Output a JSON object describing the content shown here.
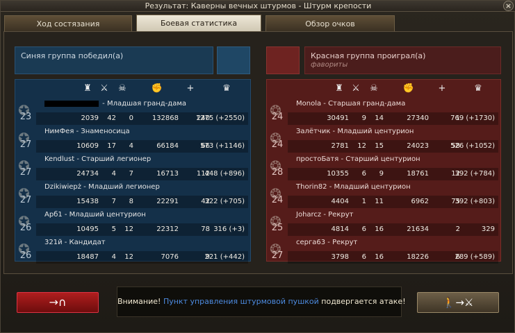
{
  "title": "Результат: Каверны вечных штурмов - Штурм крепости",
  "tabs": [
    "Ход состязания",
    "Боевая статистика",
    "Обзор очков"
  ],
  "blue": {
    "result": "Синяя группа победил(а)",
    "players": [
      {
        "level": "23",
        "name": " - Младшая гранд-дама",
        "redacted": true,
        "stats": [
          "2039",
          "42",
          "0",
          "132868",
          "240",
          "1275 (+2550)"
        ]
      },
      {
        "level": "27",
        "name": "НимФея - Знаменосица",
        "stats": [
          "10609",
          "17",
          "4",
          "66184",
          "66",
          "573 (+1146)"
        ]
      },
      {
        "level": "27",
        "name": "Kendlust - Старший легионер",
        "stats": [
          "24734",
          "4",
          "7",
          "16713",
          "112",
          "448 (+896)"
        ]
      },
      {
        "level": "27",
        "name": "Dzikiwiepż - Младший легионер",
        "stats": [
          "15438",
          "7",
          "8",
          "22291",
          "42",
          "322 (+705)"
        ]
      },
      {
        "level": "26",
        "name": "Арб1 - Младший центурион",
        "stats": [
          "10495",
          "5",
          "12",
          "22312",
          "78",
          "316 (+3)"
        ]
      },
      {
        "level": "26",
        "name": "321й - Кандидат",
        "stats": [
          "18487",
          "4",
          "12",
          "7076",
          "9",
          "221 (+442)"
        ]
      }
    ]
  },
  "red": {
    "result": "Красная группа проиграл(а)",
    "favorite": "фавориты",
    "players": [
      {
        "level": "24",
        "name": "Monola - Старшая гранд-дама",
        "stats": [
          "30491",
          "9",
          "14",
          "27340",
          "1",
          "769 (+1730)"
        ]
      },
      {
        "level": "24",
        "name": "Залётчик - Младший центурион",
        "stats": [
          "2781",
          "12",
          "15",
          "24023",
          "58",
          "526 (+1052)"
        ]
      },
      {
        "level": "28",
        "name": "простоБатя - Старший центурион",
        "stats": [
          "10355",
          "6",
          "9",
          "18761",
          "12",
          "392 (+784)"
        ]
      },
      {
        "level": "24",
        "name": "Thorin82 - Младший центурион",
        "stats": [
          "4404",
          "1",
          "11",
          "6962",
          "75",
          "392 (+803)"
        ]
      },
      {
        "level": "25",
        "name": "Joharcz - Рекрут",
        "stats": [
          "4814",
          "6",
          "16",
          "21634",
          "2",
          "329"
        ]
      },
      {
        "level": "27",
        "name": "серга63 - Рекрут",
        "stats": [
          "3798",
          "6",
          "16",
          "18226",
          "6",
          "289 (+589)"
        ]
      }
    ]
  },
  "notice": {
    "warning": "Внимание!",
    "target": "Пункт управления штурмовой пушкой",
    "text": "подвергается атаке!"
  },
  "icons": {
    "tower": "♜",
    "swords": "⚔",
    "skull": "☠",
    "fist": "✊",
    "plus": "+",
    "crown": "♛"
  }
}
